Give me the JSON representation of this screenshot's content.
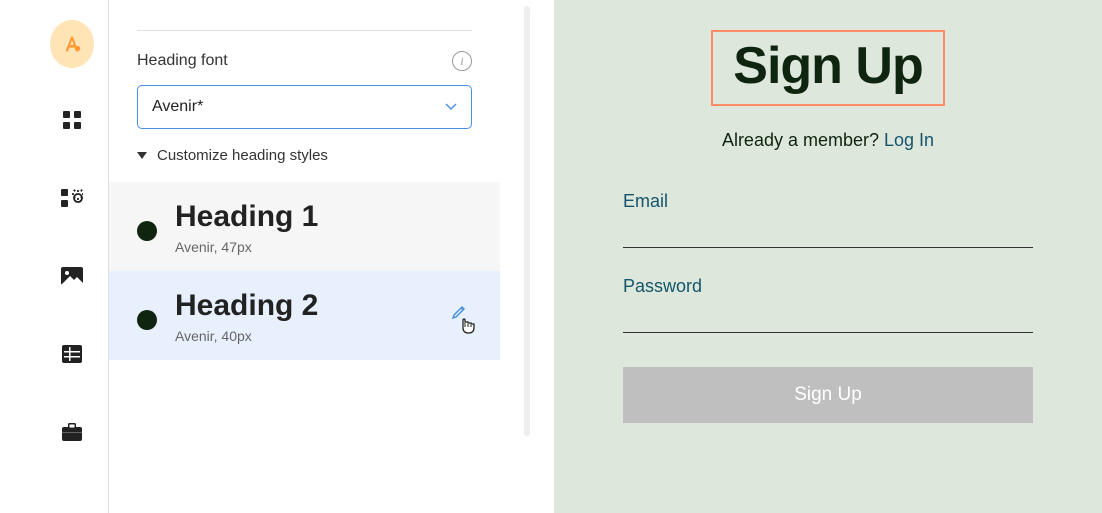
{
  "sidebar": {
    "icons": [
      "fonts-icon",
      "grid-icon",
      "settings-icon",
      "image-icon",
      "table-icon",
      "briefcase-icon"
    ]
  },
  "panel": {
    "heading_font_label": "Heading font",
    "font_value": "Avenir*",
    "customize_label": "Customize heading styles",
    "headings": [
      {
        "title": "Heading 1",
        "sub": "Avenir, 47px"
      },
      {
        "title": "Heading 2",
        "sub": "Avenir, 40px"
      }
    ]
  },
  "preview": {
    "title": "Sign Up",
    "member_text": "Already a member? ",
    "login_text": "Log In",
    "email_label": "Email",
    "password_label": "Password",
    "button_label": "Sign Up"
  }
}
